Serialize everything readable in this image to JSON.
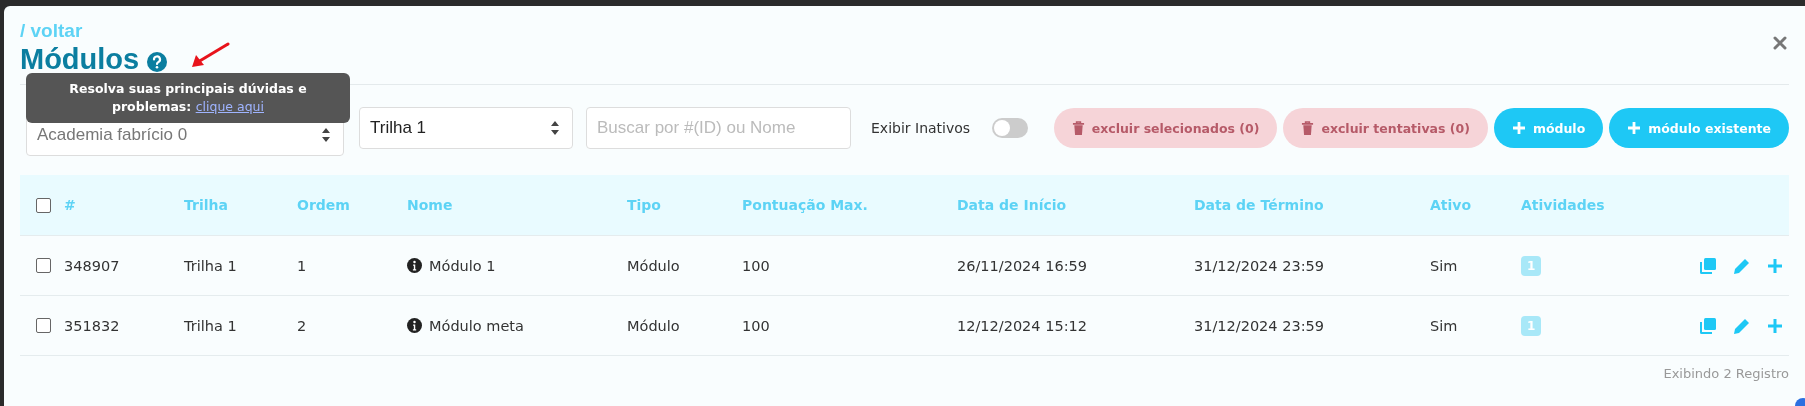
{
  "back_link": "/ voltar",
  "title": "Módulos",
  "tooltip": {
    "text": "Resolva suas principais dúvidas e problemas:",
    "link": "clique aqui"
  },
  "filters": {
    "academy_select": "Academia fabrício 0",
    "track_select": "Trilha 1",
    "search": {
      "placeholder": "Buscar por #(ID) ou Nome"
    },
    "show_inactive": {
      "label": "Exibir Inativos",
      "on": false
    }
  },
  "buttons": [
    {
      "label": "excluir selecionados (0)",
      "kind": "delete",
      "disabled": true
    },
    {
      "label": "excluir tentativas (0)",
      "kind": "delete",
      "disabled": true
    },
    {
      "label": "módulo",
      "kind": "add",
      "disabled": false
    },
    {
      "label": "módulo existente",
      "kind": "add",
      "disabled": false
    }
  ],
  "table": {
    "select_all_checked": false,
    "columns": [
      "#",
      "Trilha",
      "Ordem",
      "Nome",
      "Tipo",
      "Pontuação Max.",
      "Data de Início",
      "Data de Término",
      "Ativo",
      "Atividades"
    ],
    "rows": [
      {
        "checked": false,
        "cells": [
          "348907",
          "Trilha 1",
          "1",
          "Módulo 1",
          "Módulo",
          "100",
          "26/11/2024 16:59",
          "31/12/2024 23:59",
          "Sim",
          "1"
        ]
      },
      {
        "checked": false,
        "cells": [
          "351832",
          "Trilha 1",
          "2",
          "Módulo meta",
          "Módulo",
          "100",
          "12/12/2024 15:12",
          "31/12/2024 23:59",
          "Sim",
          "1"
        ]
      }
    ]
  },
  "footer": "Exibindo 2 Registro"
}
